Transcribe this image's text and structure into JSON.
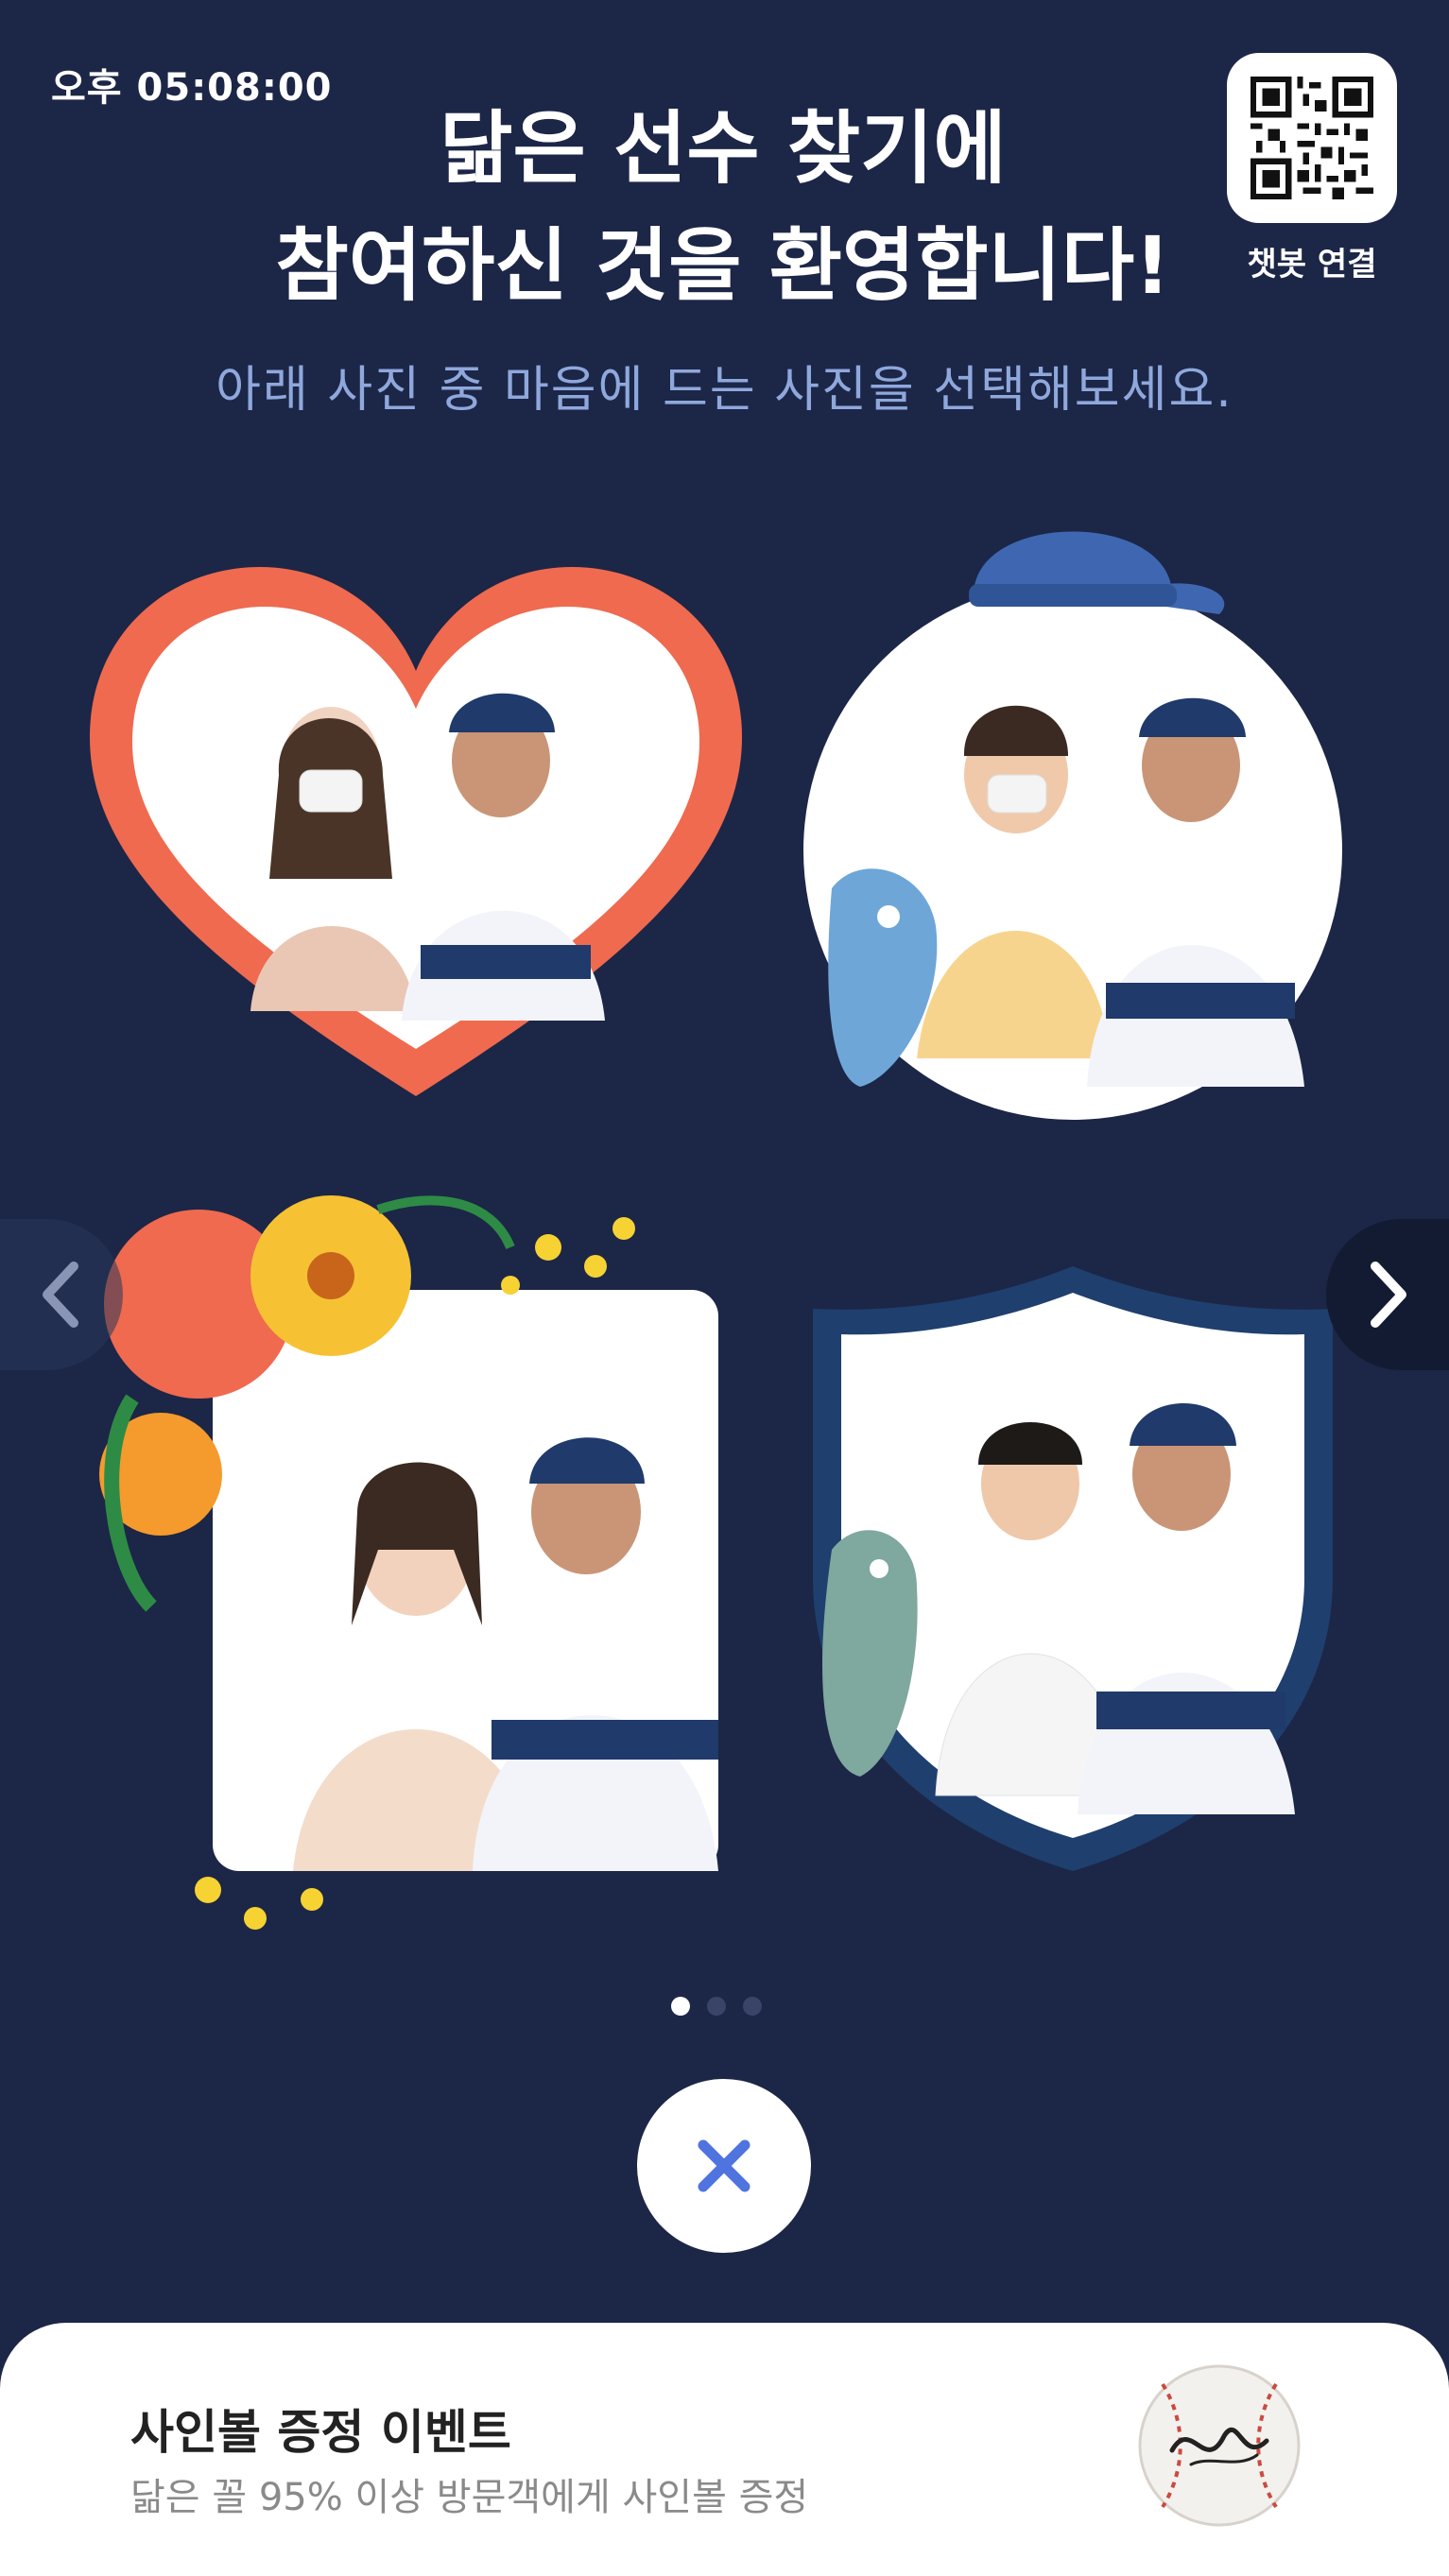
{
  "status": {
    "time": "오후 05:08:00"
  },
  "header": {
    "title_line1": "닮은 선수 찾기에",
    "title_line2": "참여하신 것을 환영합니다!",
    "chatbot_label": "챗봇 연결",
    "subtitle": "아래 사진 중 마음에 드는 사진을 선택해보세요."
  },
  "photos": [
    {
      "frame": "heart",
      "color": "#ef6a4f"
    },
    {
      "frame": "circle-cap",
      "color": "#3f67b1"
    },
    {
      "frame": "flower",
      "color": "#f6c233"
    },
    {
      "frame": "shield",
      "color": "#1f3f6e"
    }
  ],
  "carousel": {
    "pages": 3,
    "active_page": 1
  },
  "icons": {
    "prev": "chevron-left-icon",
    "next": "chevron-right-icon",
    "close": "close-icon",
    "qr": "qr-code-icon",
    "baseball": "signed-baseball-icon"
  },
  "event": {
    "title": "사인볼 증정 이벤트",
    "description": "닮은 꼴 95% 이상 방문객에게 사인볼 증정"
  },
  "colors": {
    "background": "#1c2647",
    "subtitle": "#8fa8dc",
    "accent_blue": "#4f74e0",
    "sheet": "#ffffff"
  }
}
